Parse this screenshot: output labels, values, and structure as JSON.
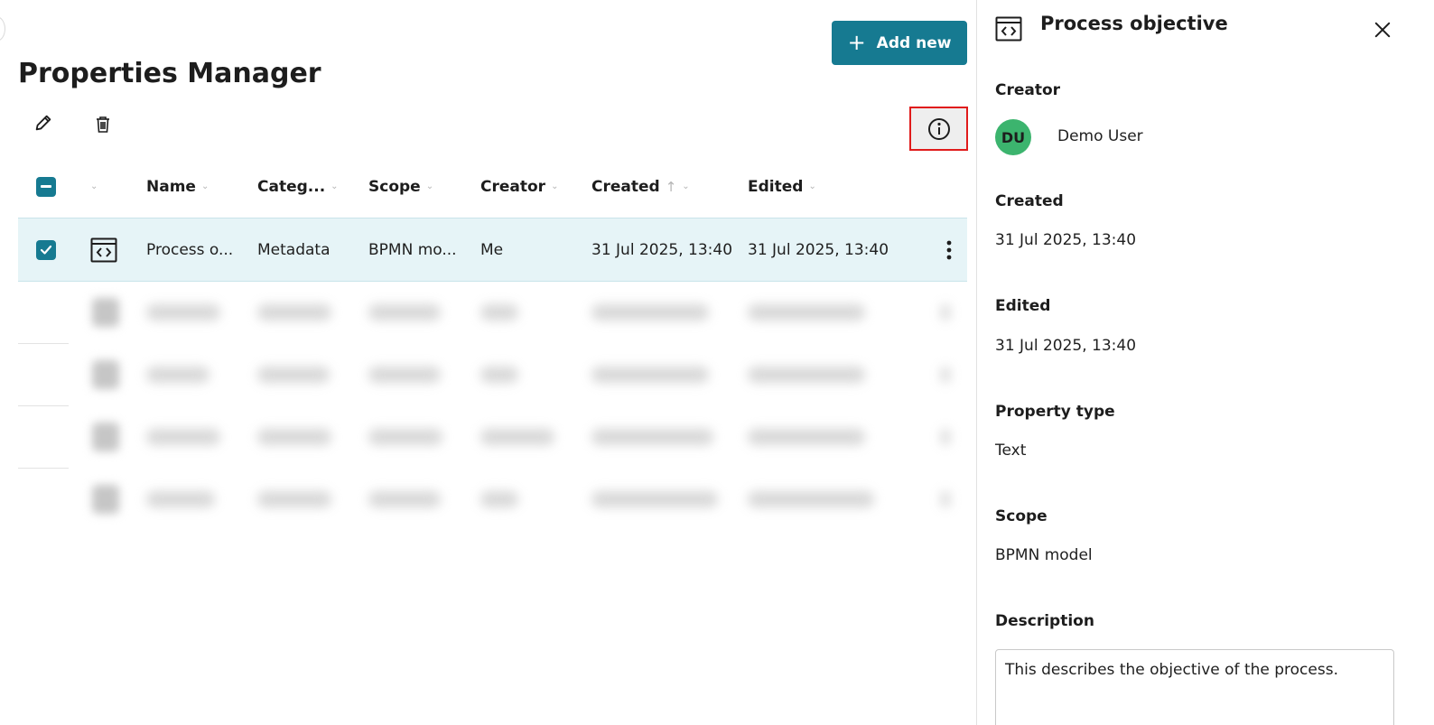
{
  "main": {
    "title": "Properties Manager",
    "add_button_label": "Add new",
    "add_button_plus": "+"
  },
  "table": {
    "columns": {
      "name": "Name",
      "category": "Categ...",
      "scope": "Scope",
      "creator": "Creator",
      "created": "Created",
      "edited": "Edited"
    },
    "selected_row": {
      "name": "Process o...",
      "category": "Metadata",
      "scope": "BPMN mo...",
      "creator": "Me",
      "created": "31 Jul 2025, 13:40",
      "edited": "31 Jul 2025, 13:40"
    }
  },
  "panel": {
    "title": "Process objective",
    "creator_label": "Creator",
    "creator_initials": "DU",
    "creator_name": "Demo User",
    "created_label": "Created",
    "created_value": "31 Jul 2025, 13:40",
    "edited_label": "Edited",
    "edited_value": "31 Jul 2025, 13:40",
    "property_type_label": "Property type",
    "property_type_value": "Text",
    "scope_label": "Scope",
    "scope_value": "BPMN model",
    "description_label": "Description",
    "description_value": "This describes the objective of the process."
  },
  "colors": {
    "accent": "#167a91",
    "selected_row_bg": "#e6f4f7",
    "avatar_bg": "#3cb46e",
    "highlight_border": "#e01b1b"
  },
  "icons": {
    "edit": "pencil-icon",
    "delete": "trash-icon",
    "info": "info-icon",
    "property_type": "code-brackets-icon",
    "close": "close-icon",
    "row_menu": "kebab-menu-icon"
  }
}
